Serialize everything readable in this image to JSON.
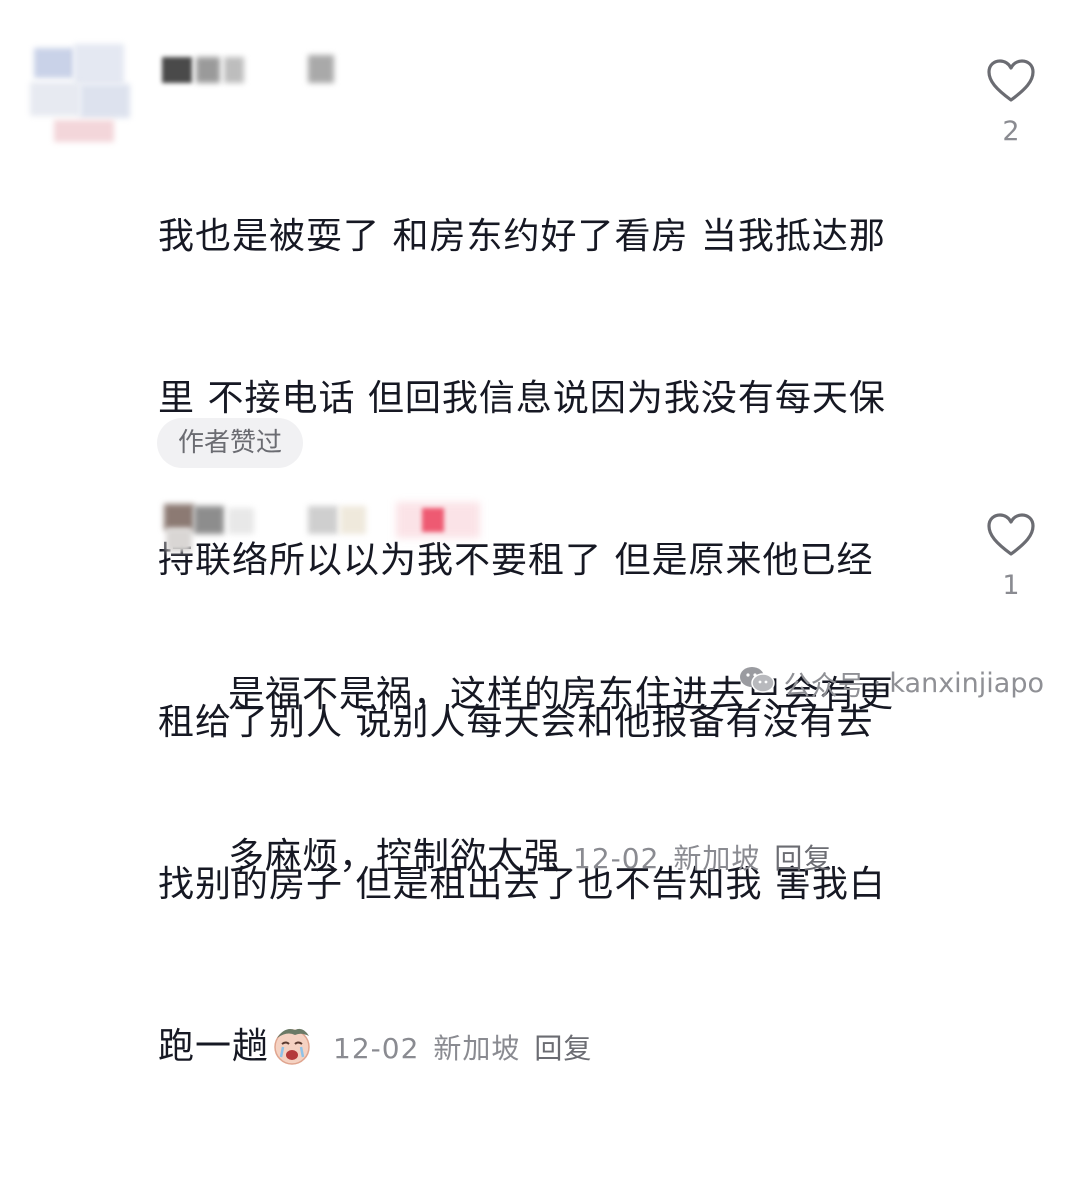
{
  "comments": [
    {
      "text": "我也是被耍了 和房东约好了看房 当我抵达那里 不接电话 但回我信息说因为我没有每天保持联络所以以为我不要租了 但是原来他已经租给了别人 说别人每天会和他报备有没有去找别的房子 但是租出去了也不告知我 害我白跑一趟",
      "lines": [
        "我也是被耍了 和房东约好了看房 当我抵达那",
        "里 不接电话 但回我信息说因为我没有每天保",
        "持联络所以以为我不要租了 但是原来他已经",
        "租给了别人 说别人每天会和他报备有没有去",
        "找别的房子 但是租出去了也不告知我 害我白",
        "跑一趟"
      ],
      "date": "12-02",
      "location": "新加坡",
      "reply_label": "回复",
      "badge": "作者赞过",
      "like_count": "2",
      "emoji_icon": "crying-face-emoji"
    },
    {
      "text": "是福不是祸，这样的房东住进去只会有更多麻烦，控制欲太强",
      "lines": [
        "是福不是祸，这样的房东住进去只会有更",
        "多麻烦，控制欲太强"
      ],
      "date": "12-02",
      "location": "新加坡",
      "reply_label": "回复",
      "like_count": "1"
    }
  ],
  "watermark": {
    "source": "公众号",
    "separator": "·",
    "account": "kanxinjiapo",
    "icon": "wechat-icon"
  },
  "colors": {
    "text": "#161823",
    "meta": "#8a8b91",
    "badge_bg": "#f1f1f3"
  }
}
